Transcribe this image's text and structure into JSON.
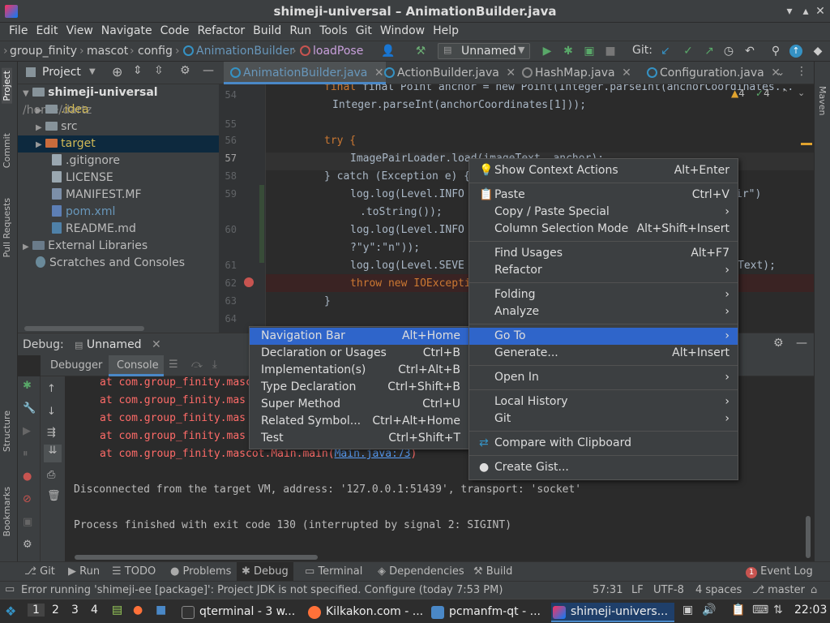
{
  "window": {
    "title": "shimeji-universal – AnimationBuilder.java"
  },
  "menubar": [
    "File",
    "Edit",
    "View",
    "Navigate",
    "Code",
    "Refactor",
    "Build",
    "Run",
    "Tools",
    "Git",
    "Window",
    "Help"
  ],
  "breadcrumb": [
    "group_finity",
    "mascot",
    "config",
    "AnimationBuilder",
    "loadPose"
  ],
  "toolbar": {
    "run_config": "Unnamed",
    "git_label": "Git:"
  },
  "project": {
    "header": "Project",
    "root": "shimeji-universal",
    "root_path": "/home/dartz",
    "items": [
      ".idea",
      "src",
      "target",
      ".gitignore",
      "LICENSE",
      "MANIFEST.MF",
      "pom.xml",
      "README.md",
      "External Libraries",
      "Scratches and Consoles"
    ]
  },
  "tabs": [
    "AnimationBuilder.java",
    "ActionBuilder.java",
    "HashMap.java",
    "Configuration.java"
  ],
  "editor": {
    "inspections": {
      "warnings": "4",
      "weak": "4"
    },
    "lines": [
      "54",
      "55",
      "56",
      "57",
      "58",
      "59",
      "60",
      "61",
      "62",
      "63",
      "64"
    ],
    "code": {
      "l0": "final Point anchor = new Point(Integer.parseInt(anchorCoordinates...",
      "l1": "Integer.parseInt(anchorCoordinates[1]));",
      "l3a": "try {",
      "l4": "ImagePairLoader.load(imageText, anchor);",
      "l5a": "} catch (Exception e) {",
      "l6a": "log.log(Level.INFO",
      "l6b": "ir\")",
      "l7": ".toString());",
      "l8a": "log.log(Level.INFO",
      "l9": "?\"y\":\"n\"));",
      "l10a": "log.log(Level.SEVE",
      "l10b": "Text);",
      "l11a": "throw new IOExcepti",
      "l12": "}"
    }
  },
  "debug": {
    "label": "Debug:",
    "config": "Unnamed",
    "tabs": [
      "Debugger",
      "Console"
    ],
    "console_lines": [
      "at com.group_finity.masc",
      "at com.group_finity.mas",
      "at com.group_finity.mas",
      "at com.group_finity.mas",
      "at com.group_finity.mascot.Main.main(",
      "Disconnected from the target VM, address: '127.0.0.1:51439', transport: 'socket'",
      "Process finished with exit code 130 (interrupted by signal 2: SIGINT)"
    ],
    "link": "Main.java:73",
    "link_suffix": ")"
  },
  "context_menu": {
    "items": [
      {
        "label": "Show Context Actions",
        "shortcut": "Alt+Enter"
      },
      {
        "label": "Paste",
        "shortcut": "Ctrl+V"
      },
      {
        "label": "Copy / Paste Special",
        "shortcut": ""
      },
      {
        "label": "Column Selection Mode",
        "shortcut": "Alt+Shift+Insert"
      },
      {
        "label": "Find Usages",
        "shortcut": "Alt+F7"
      },
      {
        "label": "Refactor",
        "shortcut": ""
      },
      {
        "label": "Folding",
        "shortcut": ""
      },
      {
        "label": "Analyze",
        "shortcut": ""
      },
      {
        "label": "Go To",
        "shortcut": ""
      },
      {
        "label": "Generate...",
        "shortcut": "Alt+Insert"
      },
      {
        "label": "Open In",
        "shortcut": ""
      },
      {
        "label": "Local History",
        "shortcut": ""
      },
      {
        "label": "Git",
        "shortcut": ""
      },
      {
        "label": "Compare with Clipboard",
        "shortcut": ""
      },
      {
        "label": "Create Gist...",
        "shortcut": ""
      }
    ]
  },
  "goto_menu": {
    "items": [
      {
        "label": "Navigation Bar",
        "shortcut": "Alt+Home"
      },
      {
        "label": "Declaration or Usages",
        "shortcut": "Ctrl+B"
      },
      {
        "label": "Implementation(s)",
        "shortcut": "Ctrl+Alt+B"
      },
      {
        "label": "Type Declaration",
        "shortcut": "Ctrl+Shift+B"
      },
      {
        "label": "Super Method",
        "shortcut": "Ctrl+U"
      },
      {
        "label": "Related Symbol...",
        "shortcut": "Ctrl+Alt+Home"
      },
      {
        "label": "Test",
        "shortcut": "Ctrl+Shift+T"
      }
    ]
  },
  "left_strip": [
    "Project",
    "Commit",
    "Pull Requests",
    "Structure",
    "Bookmarks"
  ],
  "right_strip": [
    "Maven"
  ],
  "toolwindows": [
    "Git",
    "Run",
    "TODO",
    "Problems",
    "Debug",
    "Terminal",
    "Dependencies",
    "Build"
  ],
  "event_log": {
    "count": "1",
    "label": "Event Log"
  },
  "status": {
    "message": "Error running 'shimeji-ee [package]': Project JDK is not specified. Configure (today 7:53 PM)",
    "position": "57:31",
    "line_sep": "LF",
    "encoding": "UTF-8",
    "indent": "4 spaces",
    "branch": "master"
  },
  "taskbar": {
    "workspaces": [
      "1",
      "2",
      "3",
      "4"
    ],
    "apps": [
      "qterminal - 3 w...",
      "Kilkakon.com - ...",
      "pcmanfm-qt - ...",
      "shimeji-univers..."
    ],
    "clock": "22:03"
  },
  "colors": {
    "accent": "#2f65ca",
    "bg": "#2b2b2b",
    "panel": "#3c3f41",
    "error": "#ff6b68"
  }
}
